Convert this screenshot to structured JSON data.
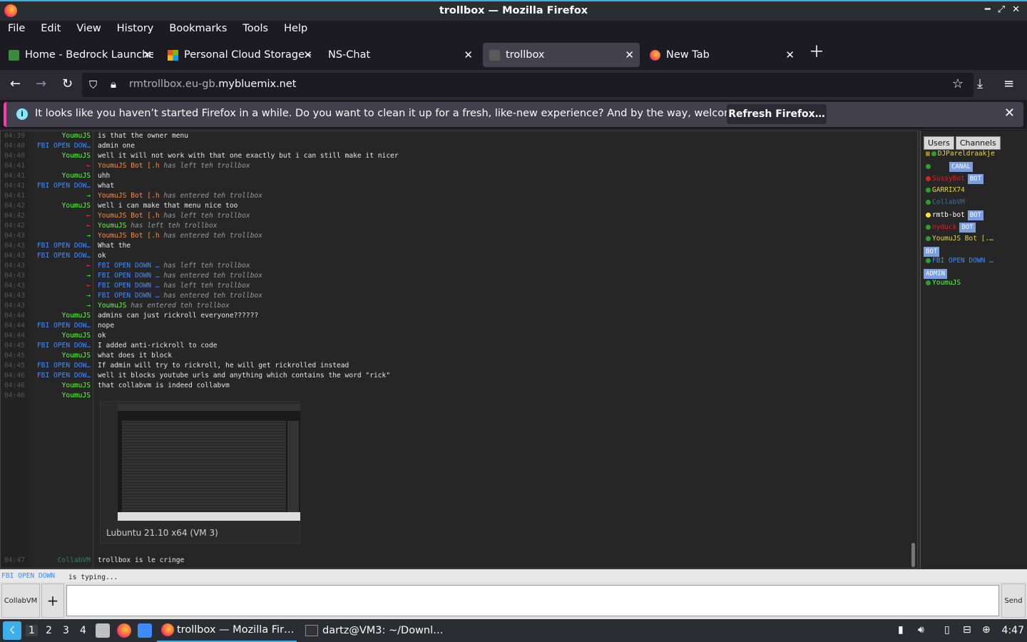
{
  "window": {
    "title": "trollbox — Mozilla Firefox"
  },
  "menu": [
    "File",
    "Edit",
    "View",
    "History",
    "Bookmarks",
    "Tools",
    "Help"
  ],
  "tabs": [
    {
      "label": "Home - Bedrock Launcher",
      "icon": "bedrock-icon"
    },
    {
      "label": "Personal Cloud Storage -",
      "icon": "windows-logo-icon"
    },
    {
      "label": "NS-Chat",
      "icon": ""
    },
    {
      "label": "trollbox",
      "icon": "trollbox-icon",
      "active": true
    },
    {
      "label": "New Tab",
      "icon": "firefox-icon"
    }
  ],
  "url": {
    "prefix": "rmtrollbox.eu-gb.",
    "domain": "mybluemix.net"
  },
  "notification": {
    "message": "It looks like you haven’t started Firefox in a while. Do you want to clean it up for a fresh, like-new experience? And by the way, welcome back!",
    "button": "Refresh Firefox…"
  },
  "messages": [
    {
      "time": "04:39",
      "name": "YoumuJS",
      "color": "g",
      "text": "is that the owner menu"
    },
    {
      "time": "04:40",
      "name": "FBI OPEN DOW…",
      "color": "b",
      "text": "admin one"
    },
    {
      "time": "04:40",
      "name": "YoumuJS",
      "color": "g",
      "text": "well it will not work with that one exactly but i can still make it nicer"
    },
    {
      "time": "04:41",
      "name": "←",
      "color": "arrow-out",
      "sys": true,
      "who": "YoumuJS Bot [.h",
      "whoColor": "o",
      "text": " has left teh trollbox"
    },
    {
      "time": "04:41",
      "name": "YoumuJS",
      "color": "g",
      "text": "uhh"
    },
    {
      "time": "04:41",
      "name": "FBI OPEN DOW…",
      "color": "b",
      "text": "what"
    },
    {
      "time": "04:41",
      "name": "→",
      "color": "arrow-in",
      "sys": true,
      "who": "YoumuJS Bot [.h",
      "whoColor": "o",
      "text": " has entered teh trollbox"
    },
    {
      "time": "04:42",
      "name": "YoumuJS",
      "color": "g",
      "text": "well i can make that menu nice too"
    },
    {
      "time": "04:42",
      "name": "←",
      "color": "arrow-out",
      "sys": true,
      "who": "YoumuJS Bot [.h",
      "whoColor": "o",
      "text": " has left teh trollbox"
    },
    {
      "time": "04:42",
      "name": "←",
      "color": "arrow-out",
      "sys": true,
      "who": "YoumuJS",
      "whoColor": "g",
      "text": " has left teh trollbox"
    },
    {
      "time": "04:43",
      "name": "→",
      "color": "arrow-in",
      "sys": true,
      "who": "YoumuJS Bot [.h",
      "whoColor": "o",
      "text": " has entered teh trollbox"
    },
    {
      "time": "04:43",
      "name": "FBI OPEN DOW…",
      "color": "b",
      "text": "What the"
    },
    {
      "time": "04:43",
      "name": "FBI OPEN DOW…",
      "color": "b",
      "text": "ok"
    },
    {
      "time": "04:43",
      "name": "←",
      "color": "arrow-out",
      "sys": true,
      "who": "FBI OPEN DOWN …",
      "whoColor": "b",
      "text": " has left teh trollbox"
    },
    {
      "time": "04:43",
      "name": "→",
      "color": "arrow-in",
      "sys": true,
      "who": "FBI OPEN DOWN …",
      "whoColor": "b",
      "text": " has entered teh trollbox"
    },
    {
      "time": "04:43",
      "name": "←",
      "color": "arrow-out",
      "sys": true,
      "who": "FBI OPEN DOWN …",
      "whoColor": "b",
      "text": " has left teh trollbox"
    },
    {
      "time": "04:43",
      "name": "→",
      "color": "arrow-in",
      "sys": true,
      "who": "FBI OPEN DOWN …",
      "whoColor": "b",
      "text": " has entered teh trollbox"
    },
    {
      "time": "04:43",
      "name": "→",
      "color": "arrow-in",
      "sys": true,
      "who": "YoumuJS",
      "whoColor": "g",
      "text": " has entered teh trollbox"
    },
    {
      "time": "04:44",
      "name": "YoumuJS",
      "color": "g",
      "text": "admins can just rickroll everyone??????"
    },
    {
      "time": "04:44",
      "name": "FBI OPEN DOW…",
      "color": "b",
      "text": "nope"
    },
    {
      "time": "04:44",
      "name": "YoumuJS",
      "color": "g",
      "text": "ok"
    },
    {
      "time": "04:45",
      "name": "FBI OPEN DOW…",
      "color": "b",
      "text": "I added anti-rickroll to code"
    },
    {
      "time": "04:45",
      "name": "YoumuJS",
      "color": "g",
      "text": "what does it block"
    },
    {
      "time": "04:45",
      "name": "FBI OPEN DOW…",
      "color": "b",
      "text": "If admin will try to rickroll, he will get rickrolled instead"
    },
    {
      "time": "04:46",
      "name": "FBI OPEN DOW…",
      "color": "b",
      "text": "well it blocks youtube urls and anything which contains the word \"rick\""
    },
    {
      "time": "04:46",
      "name": "YoumuJS",
      "color": "g",
      "text": "that collabvm is indeed collabvm"
    },
    {
      "time": "04:46",
      "name": "YoumuJS",
      "color": "g",
      "text": ""
    }
  ],
  "embed": {
    "caption": "Lubuntu 21.10 x64 (VM 3)"
  },
  "last_message": {
    "time": "04:47",
    "name": "CollabVM",
    "text": "trollbox is le cringe"
  },
  "user_panel": {
    "tabs": [
      "Users",
      "Channels"
    ],
    "users": [
      {
        "name": "DJPareldraakje",
        "dot": "#2e9e2e",
        "color": "#e8d44d",
        "prefix": "▦"
      },
      {
        "name": "",
        "dot": "#2e9e2e",
        "color": "#3d3dff",
        "badge": "CANAL"
      },
      {
        "name": "SussyBot",
        "dot": "#e02020",
        "color": "#e02020",
        "badge": "BOT"
      },
      {
        "name": "GARRIX74",
        "dot": "#2e9e2e",
        "color": "#e8d44d"
      },
      {
        "name": "CollabVM",
        "dot": "#2e9e2e",
        "color": "#3d6f9e"
      },
      {
        "name": "rmtb-bot",
        "dot": "#ffe23a",
        "color": "#ffffff",
        "badge": "BOT"
      },
      {
        "name": "nyduck",
        "dot": "#2e9e2e",
        "color": "#e02020",
        "badge": "BOT"
      },
      {
        "name": "YoumuJS Bot [.…",
        "dot": "#2e9e2e",
        "color": "#e8d44d",
        "badgeNext": "BOT"
      },
      {
        "name": "FBI OPEN DOWN …",
        "dot": "#2e9e2e",
        "color": "#3d8cff",
        "badgeNext": "ADMIN"
      },
      {
        "name": "YoumuJS",
        "dot": "#2e9e2e",
        "color": "#5aff3a"
      }
    ]
  },
  "typing": {
    "name": "FBI OPEN DOWN",
    "text": "is typing..."
  },
  "input": {
    "room": "CollabVM",
    "plus": "+",
    "send": "Send"
  },
  "taskbar": {
    "desktops": [
      "1",
      "2",
      "3",
      "4"
    ],
    "tasks": [
      {
        "label": "trollbox — Mozilla Fir…",
        "active": true
      },
      {
        "label": "dartz@VM3: ~/Downl…"
      }
    ],
    "clock": "4:47"
  }
}
